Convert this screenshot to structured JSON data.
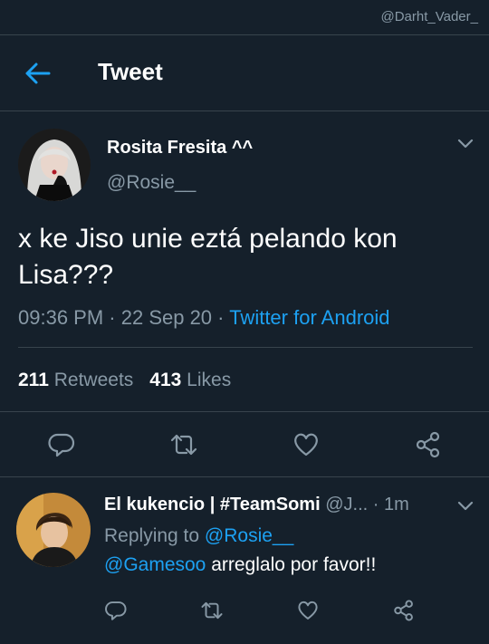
{
  "watermark": "@Darht_Vader_",
  "header": {
    "title": "Tweet"
  },
  "tweet": {
    "author_name": "Rosita Fresita ^^",
    "author_handle": "@Rosie__",
    "text": "x ke Jiso unie eztá pelando kon Lisa???",
    "time": "09:36 PM",
    "sep1": " · ",
    "date": "22 Sep 20",
    "sep2": " · ",
    "client": "Twitter for Android",
    "retweets_count": "211",
    "retweets_label": "Retweets",
    "likes_count": "413",
    "likes_label": "Likes"
  },
  "reply": {
    "author_name": "El kukencio | #TeamSomi",
    "author_handle": "@J...",
    "dot": " · ",
    "time": "1m",
    "replying_prefix": "Replying to ",
    "replying_to": "@Rosie__",
    "mention": "@Gamesoo",
    "text": " arreglalo por favor!!"
  },
  "colors": {
    "background": "#15202b",
    "divider": "#38444d",
    "muted": "#8899a6",
    "accent": "#1da1f2"
  },
  "icons": [
    "back-arrow-icon",
    "chevron-down-icon",
    "reply-icon",
    "retweet-icon",
    "like-icon",
    "share-icon"
  ]
}
